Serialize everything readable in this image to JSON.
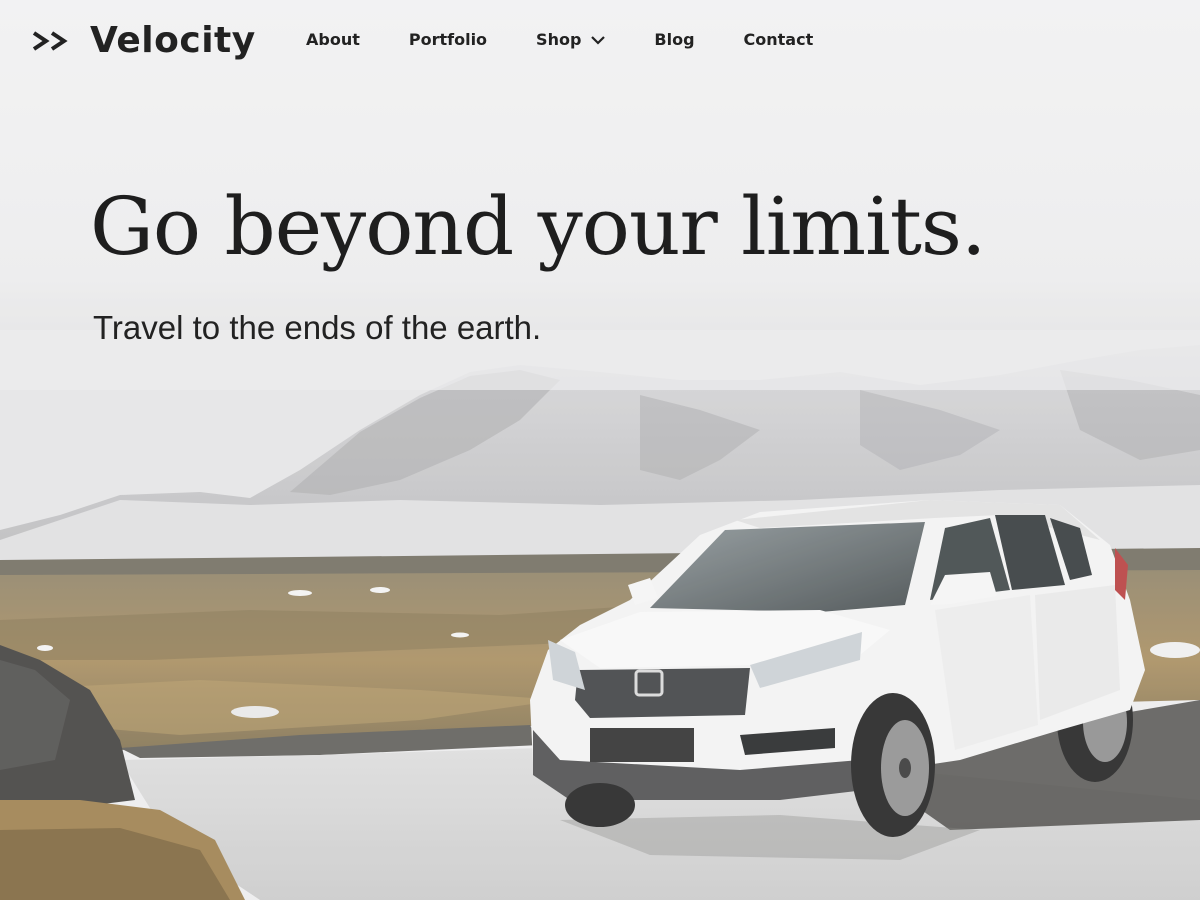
{
  "brand": {
    "name": "Velocity",
    "logo_icon": "double-chevron-right-icon"
  },
  "nav": {
    "items": [
      {
        "label": "About"
      },
      {
        "label": "Portfolio"
      },
      {
        "label": "Shop",
        "dropdown_icon": "chevron-down-icon"
      },
      {
        "label": "Blog"
      },
      {
        "label": "Contact"
      }
    ]
  },
  "hero": {
    "title": "Go beyond your limits.",
    "subtitle": "Travel to the ends of the earth."
  },
  "colors": {
    "text": "#222222",
    "sky": "#ececed",
    "grass": "#9c8456",
    "car": "#f3f3f3"
  }
}
